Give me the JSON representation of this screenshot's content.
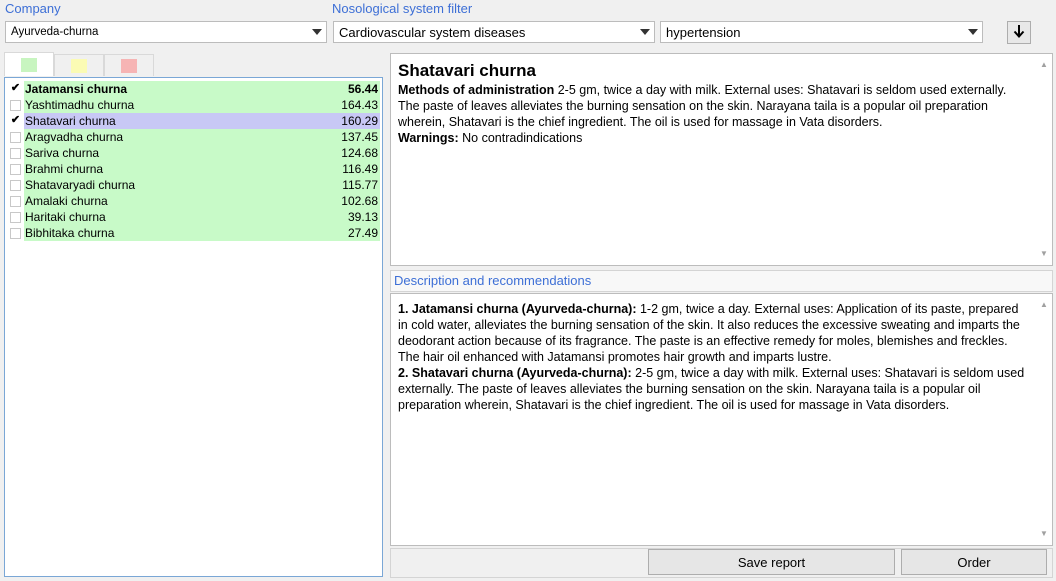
{
  "filters": {
    "company_label": "Company",
    "company_value": "Ayurveda-churna",
    "nosology_label": "Nosological system filter",
    "system_value": "Cardiovascular system diseases",
    "disease_value": "hypertension"
  },
  "tabs": [
    {
      "color": "#c8f5c0",
      "active": true
    },
    {
      "color": "#fbfbb4",
      "active": false
    },
    {
      "color": "#f6b4b4",
      "active": false
    }
  ],
  "products": [
    {
      "name": "Jatamansi churna",
      "score": "56.44",
      "checked": true,
      "bold": true,
      "selected": false
    },
    {
      "name": "Yashtimadhu churna",
      "score": "164.43",
      "checked": false,
      "bold": false,
      "selected": false
    },
    {
      "name": "Shatavari churna",
      "score": "160.29",
      "checked": true,
      "bold": false,
      "selected": true
    },
    {
      "name": "Aragvadha churna",
      "score": "137.45",
      "checked": false,
      "bold": false,
      "selected": false
    },
    {
      "name": "Sariva churna",
      "score": "124.68",
      "checked": false,
      "bold": false,
      "selected": false
    },
    {
      "name": "Brahmi churna",
      "score": "116.49",
      "checked": false,
      "bold": false,
      "selected": false
    },
    {
      "name": "Shatavaryadi churna",
      "score": "115.77",
      "checked": false,
      "bold": false,
      "selected": false
    },
    {
      "name": "Amalaki churna",
      "score": "102.68",
      "checked": false,
      "bold": false,
      "selected": false
    },
    {
      "name": "Haritaki churna",
      "score": "39.13",
      "checked": false,
      "bold": false,
      "selected": false
    },
    {
      "name": "Bibhitaka churna",
      "score": "27.49",
      "checked": false,
      "bold": false,
      "selected": false
    }
  ],
  "detail": {
    "title": "Shatavari churna",
    "methods_label": "Methods of administration",
    "methods_text": " 2-5 gm, twice a day with milk. External uses: Shatavari is seldom used externally. The paste of leaves alleviates the burning sensation on the skin.  Narayana taila is a popular oil preparation wherein, Shatavari is the chief ingredient. The oil is used for massage in Vata disorders.",
    "warnings_label": "Warnings:",
    "warnings_text": " No contradindications"
  },
  "description": {
    "header": "Description and recommendations",
    "items": [
      {
        "title": "1. Jatamansi churna (Ayurveda-churna):",
        "text": " 1-2 gm, twice a day.  External uses:  Application of its paste, prepared in cold water, alleviates the burning sensation of the skin. It also reduces the excessive sweating and imparts the deodorant action because of its fragrance. The paste  is an effective remedy for moles, blemishes and freckles. The hair oil enhanced with Jatamansi  promotes hair growth and imparts lustre."
      },
      {
        "title": "2. Shatavari churna (Ayurveda-churna):",
        "text": " 2-5 gm, twice a day with milk.  External uses: Shatavari is seldom used externally. The paste of leaves alleviates the burning sensation on the skin.  Narayana taila is a popular oil preparation wherein, Shatavari is the chief ingredient. The oil is used for massage in Vata disorders."
      }
    ]
  },
  "buttons": {
    "save_report": "Save report",
    "order": "Order"
  },
  "icons": {
    "sort": "arrow-down-icon",
    "dropdown": "chevron-down-icon",
    "check": "✔"
  }
}
